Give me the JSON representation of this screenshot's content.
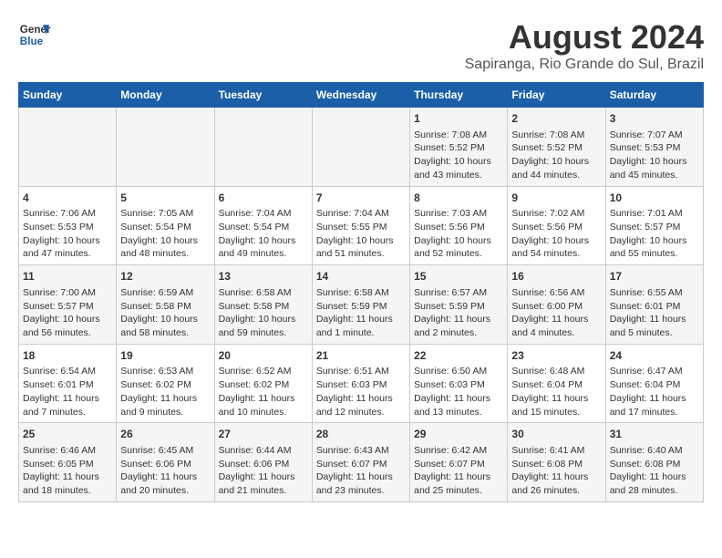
{
  "header": {
    "logo_line1": "General",
    "logo_line2": "Blue",
    "title": "August 2024",
    "subtitle": "Sapiranga, Rio Grande do Sul, Brazil"
  },
  "calendar": {
    "days_of_week": [
      "Sunday",
      "Monday",
      "Tuesday",
      "Wednesday",
      "Thursday",
      "Friday",
      "Saturday"
    ],
    "weeks": [
      [
        {
          "day": "",
          "info": ""
        },
        {
          "day": "",
          "info": ""
        },
        {
          "day": "",
          "info": ""
        },
        {
          "day": "",
          "info": ""
        },
        {
          "day": "1",
          "info": "Sunrise: 7:08 AM\nSunset: 5:52 PM\nDaylight: 10 hours\nand 43 minutes."
        },
        {
          "day": "2",
          "info": "Sunrise: 7:08 AM\nSunset: 5:52 PM\nDaylight: 10 hours\nand 44 minutes."
        },
        {
          "day": "3",
          "info": "Sunrise: 7:07 AM\nSunset: 5:53 PM\nDaylight: 10 hours\nand 45 minutes."
        }
      ],
      [
        {
          "day": "4",
          "info": "Sunrise: 7:06 AM\nSunset: 5:53 PM\nDaylight: 10 hours\nand 47 minutes."
        },
        {
          "day": "5",
          "info": "Sunrise: 7:05 AM\nSunset: 5:54 PM\nDaylight: 10 hours\nand 48 minutes."
        },
        {
          "day": "6",
          "info": "Sunrise: 7:04 AM\nSunset: 5:54 PM\nDaylight: 10 hours\nand 49 minutes."
        },
        {
          "day": "7",
          "info": "Sunrise: 7:04 AM\nSunset: 5:55 PM\nDaylight: 10 hours\nand 51 minutes."
        },
        {
          "day": "8",
          "info": "Sunrise: 7:03 AM\nSunset: 5:56 PM\nDaylight: 10 hours\nand 52 minutes."
        },
        {
          "day": "9",
          "info": "Sunrise: 7:02 AM\nSunset: 5:56 PM\nDaylight: 10 hours\nand 54 minutes."
        },
        {
          "day": "10",
          "info": "Sunrise: 7:01 AM\nSunset: 5:57 PM\nDaylight: 10 hours\nand 55 minutes."
        }
      ],
      [
        {
          "day": "11",
          "info": "Sunrise: 7:00 AM\nSunset: 5:57 PM\nDaylight: 10 hours\nand 56 minutes."
        },
        {
          "day": "12",
          "info": "Sunrise: 6:59 AM\nSunset: 5:58 PM\nDaylight: 10 hours\nand 58 minutes."
        },
        {
          "day": "13",
          "info": "Sunrise: 6:58 AM\nSunset: 5:58 PM\nDaylight: 10 hours\nand 59 minutes."
        },
        {
          "day": "14",
          "info": "Sunrise: 6:58 AM\nSunset: 5:59 PM\nDaylight: 11 hours\nand 1 minute."
        },
        {
          "day": "15",
          "info": "Sunrise: 6:57 AM\nSunset: 5:59 PM\nDaylight: 11 hours\nand 2 minutes."
        },
        {
          "day": "16",
          "info": "Sunrise: 6:56 AM\nSunset: 6:00 PM\nDaylight: 11 hours\nand 4 minutes."
        },
        {
          "day": "17",
          "info": "Sunrise: 6:55 AM\nSunset: 6:01 PM\nDaylight: 11 hours\nand 5 minutes."
        }
      ],
      [
        {
          "day": "18",
          "info": "Sunrise: 6:54 AM\nSunset: 6:01 PM\nDaylight: 11 hours\nand 7 minutes."
        },
        {
          "day": "19",
          "info": "Sunrise: 6:53 AM\nSunset: 6:02 PM\nDaylight: 11 hours\nand 9 minutes."
        },
        {
          "day": "20",
          "info": "Sunrise: 6:52 AM\nSunset: 6:02 PM\nDaylight: 11 hours\nand 10 minutes."
        },
        {
          "day": "21",
          "info": "Sunrise: 6:51 AM\nSunset: 6:03 PM\nDaylight: 11 hours\nand 12 minutes."
        },
        {
          "day": "22",
          "info": "Sunrise: 6:50 AM\nSunset: 6:03 PM\nDaylight: 11 hours\nand 13 minutes."
        },
        {
          "day": "23",
          "info": "Sunrise: 6:48 AM\nSunset: 6:04 PM\nDaylight: 11 hours\nand 15 minutes."
        },
        {
          "day": "24",
          "info": "Sunrise: 6:47 AM\nSunset: 6:04 PM\nDaylight: 11 hours\nand 17 minutes."
        }
      ],
      [
        {
          "day": "25",
          "info": "Sunrise: 6:46 AM\nSunset: 6:05 PM\nDaylight: 11 hours\nand 18 minutes."
        },
        {
          "day": "26",
          "info": "Sunrise: 6:45 AM\nSunset: 6:06 PM\nDaylight: 11 hours\nand 20 minutes."
        },
        {
          "day": "27",
          "info": "Sunrise: 6:44 AM\nSunset: 6:06 PM\nDaylight: 11 hours\nand 21 minutes."
        },
        {
          "day": "28",
          "info": "Sunrise: 6:43 AM\nSunset: 6:07 PM\nDaylight: 11 hours\nand 23 minutes."
        },
        {
          "day": "29",
          "info": "Sunrise: 6:42 AM\nSunset: 6:07 PM\nDaylight: 11 hours\nand 25 minutes."
        },
        {
          "day": "30",
          "info": "Sunrise: 6:41 AM\nSunset: 6:08 PM\nDaylight: 11 hours\nand 26 minutes."
        },
        {
          "day": "31",
          "info": "Sunrise: 6:40 AM\nSunset: 6:08 PM\nDaylight: 11 hours\nand 28 minutes."
        }
      ]
    ]
  }
}
